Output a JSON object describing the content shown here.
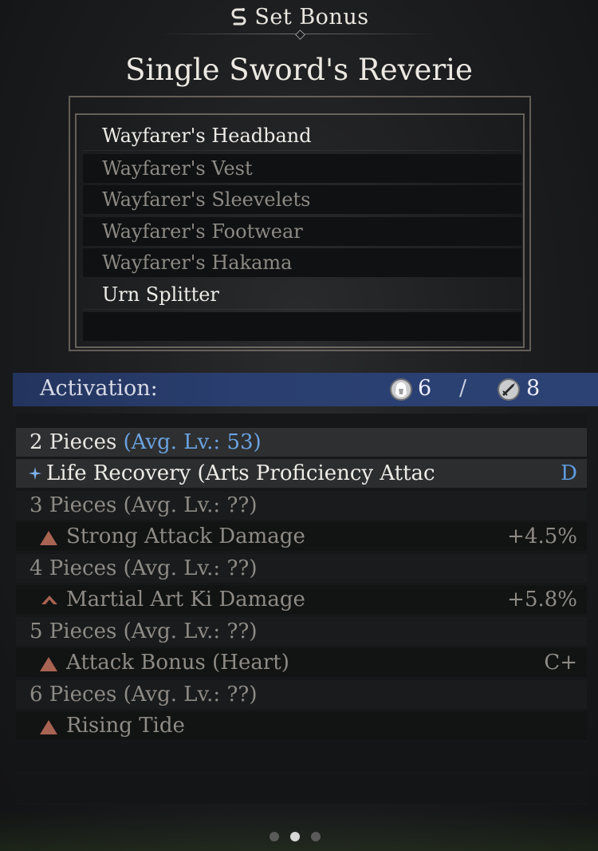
{
  "header": {
    "title": "Set Bonus",
    "icon": "set-link-icon"
  },
  "set_name": "Single Sword's Reverie",
  "pieces": [
    {
      "label": "Wayfarer's Headband",
      "owned": true
    },
    {
      "label": "Wayfarer's Vest",
      "owned": false
    },
    {
      "label": "Wayfarer's Sleevelets",
      "owned": false
    },
    {
      "label": "Wayfarer's Footwear",
      "owned": false
    },
    {
      "label": "Wayfarer's Hakama",
      "owned": false
    },
    {
      "label": "Urn Splitter",
      "owned": true
    }
  ],
  "activation": {
    "label": "Activation:",
    "equipped_count": "6",
    "separator": "/",
    "total_count": "8",
    "equipped_icon": "armor-icon",
    "total_icon": "weapon-icon"
  },
  "bonuses": [
    {
      "tier": "2 Pieces",
      "level": "(Avg. Lv.: 53)",
      "active": true,
      "effect": "Life Recovery (Arts Proficiency Attac",
      "value": "D",
      "effect_icon": "spark-icon"
    },
    {
      "tier": "3 Pieces",
      "level": "(Avg. Lv.: ??)",
      "active": false,
      "effect": "Strong Attack Damage",
      "value": "+4.5%",
      "effect_icon": "triangle-up-icon"
    },
    {
      "tier": "4 Pieces",
      "level": "(Avg. Lv.: ??)",
      "active": false,
      "effect": "Martial Art Ki Damage",
      "value": "+5.8%",
      "effect_icon": "chevron-up-icon"
    },
    {
      "tier": "5 Pieces",
      "level": "(Avg. Lv.: ??)",
      "active": false,
      "effect": "Attack Bonus (Heart)",
      "value": "C+",
      "effect_icon": "triangle-up-icon"
    },
    {
      "tier": "6 Pieces",
      "level": "(Avg. Lv.: ??)",
      "active": false,
      "effect": "Rising Tide",
      "value": "",
      "effect_icon": "triangle-up-icon"
    }
  ],
  "pagination": {
    "current": 2,
    "total": 3
  },
  "colors": {
    "accent": "#5f9ce0",
    "activation_bar": "#2a3f70",
    "triangle": "#a86353"
  }
}
